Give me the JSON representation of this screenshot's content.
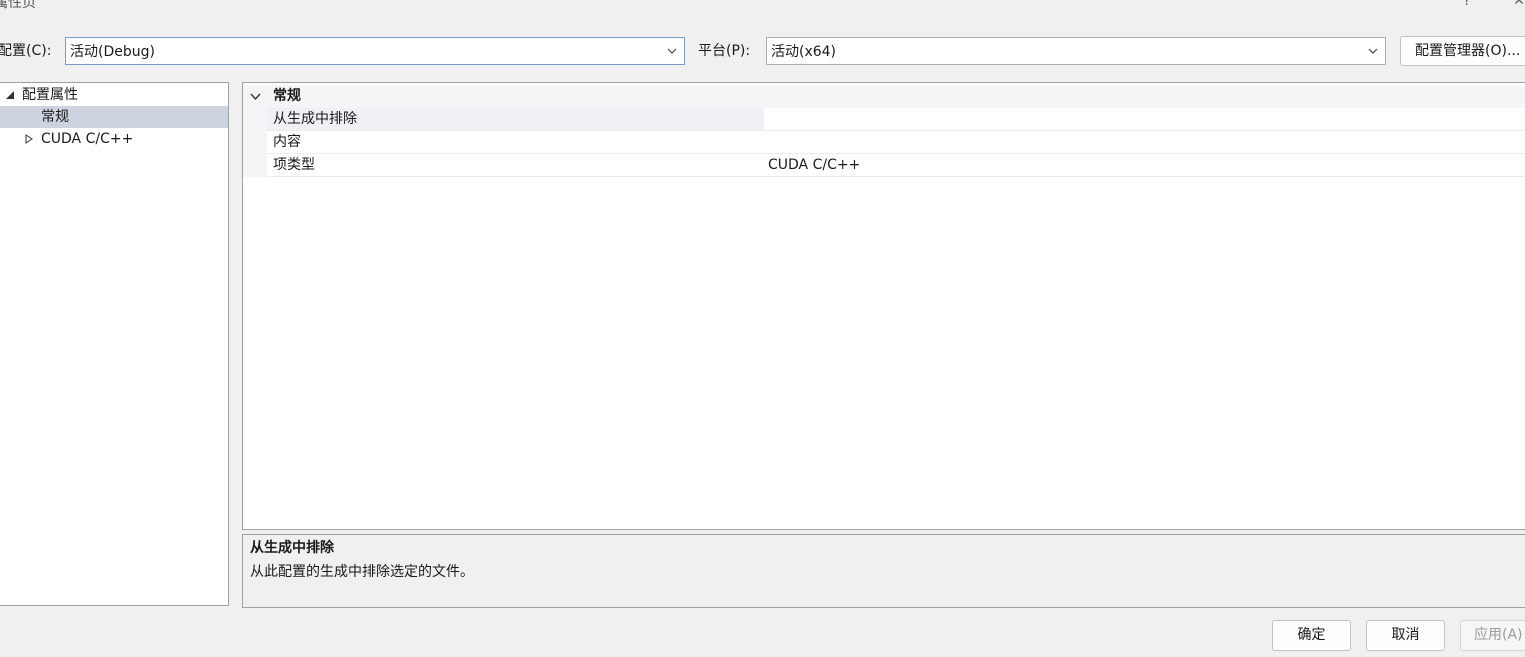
{
  "window": {
    "title": "属性页",
    "help_glyph": "?",
    "close_glyph": "✕"
  },
  "toolbar": {
    "config_label": "配置(C):",
    "config_value": "活动(Debug)",
    "platform_label": "平台(P):",
    "platform_value": "活动(x64)",
    "config_manager_label": "配置管理器(O)..."
  },
  "tree": {
    "root": {
      "label": "配置属性",
      "expanded": true
    },
    "items": [
      {
        "label": "常规",
        "selected": true
      },
      {
        "label": "CUDA C/C++",
        "selected": false,
        "expanded": false
      }
    ]
  },
  "grid": {
    "category": "常规",
    "rows": [
      {
        "name": "从生成中排除",
        "value": ""
      },
      {
        "name": "内容",
        "value": ""
      },
      {
        "name": "项类型",
        "value": "CUDA C/C++"
      }
    ]
  },
  "description": {
    "title": "从生成中排除",
    "text": "从此配置的生成中排除选定的文件。"
  },
  "buttons": {
    "ok": "确定",
    "cancel": "取消",
    "apply": "应用(A)"
  }
}
